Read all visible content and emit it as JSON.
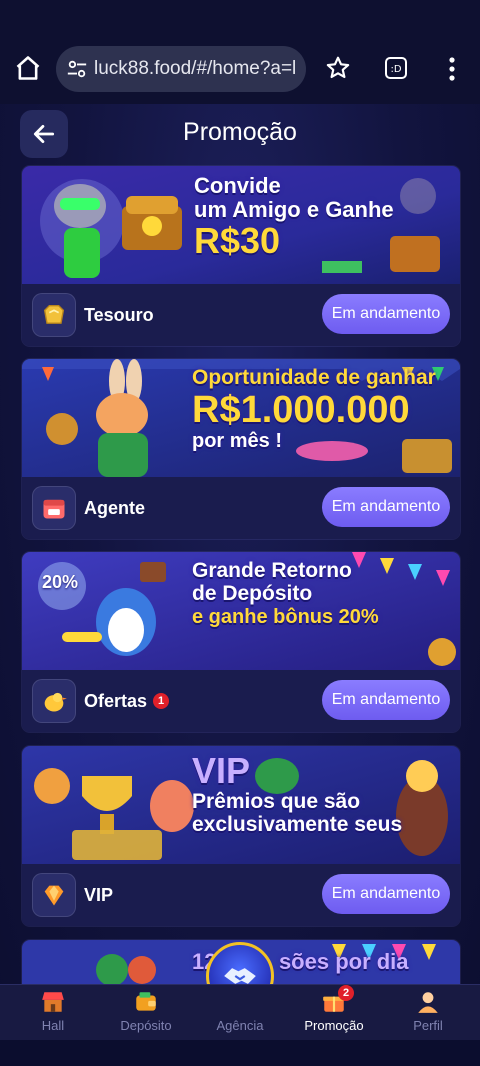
{
  "browser": {
    "url": "luck88.food/#/home?a=l"
  },
  "header": {
    "title": "Promoção"
  },
  "cards": [
    {
      "banner_lines": [
        "Convide",
        "um Amigo e Ganhe",
        "R$30"
      ],
      "label": "Tesouro",
      "status": "Em andamento"
    },
    {
      "banner_lines": [
        "Oportunidade de ganhar",
        "R$1.000.000",
        "por mês !"
      ],
      "label": "Agente",
      "status": "Em andamento"
    },
    {
      "banner_lines": [
        "Grande Retorno",
        "de Depósito",
        "e ganhe bônus 20%"
      ],
      "banner_tag": "20%",
      "label": "Ofertas",
      "badge": "1",
      "status": "Em andamento"
    },
    {
      "banner_lines": [
        "VIP",
        "Prêmios que são",
        "exclusivamente seus"
      ],
      "label": "VIP",
      "status": "Em andamento"
    },
    {
      "banner_lines": [
        "12",
        "sões por dia"
      ]
    }
  ],
  "bottom_nav": {
    "items": [
      {
        "label": "Hall",
        "icon": "shop-icon"
      },
      {
        "label": "Depósito",
        "icon": "wallet-icon"
      },
      {
        "label": "Agência",
        "icon": "handshake-icon"
      },
      {
        "label": "Promoção",
        "icon": "gift-icon",
        "badge": "2",
        "active": true
      },
      {
        "label": "Perfil",
        "icon": "person-icon"
      }
    ]
  },
  "colors": {
    "accent": "#7b6cf7",
    "background": "#12143f",
    "highlight": "#ffd93a"
  }
}
